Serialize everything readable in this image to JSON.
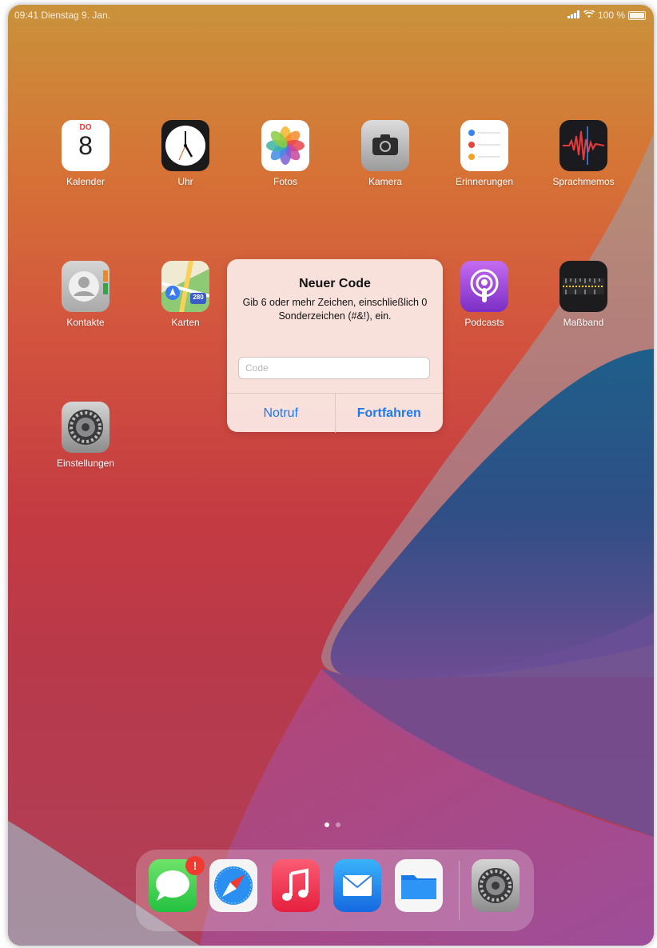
{
  "status_bar": {
    "time_date": "09:41  Dienstag 9. Jan.",
    "battery": "100 %"
  },
  "apps": [
    {
      "label": "Kalender",
      "icon": "calendar-icon",
      "day": "DO",
      "date": "8"
    },
    {
      "label": "Uhr",
      "icon": "clock-icon"
    },
    {
      "label": "Fotos",
      "icon": "photos-icon"
    },
    {
      "label": "Kamera",
      "icon": "camera-icon"
    },
    {
      "label": "Erinnerungen",
      "icon": "reminders-icon"
    },
    {
      "label": "Sprachmemos",
      "icon": "voice-memos-icon"
    },
    {
      "label": "Kontakte",
      "icon": "contacts-icon"
    },
    {
      "label": "Karten",
      "icon": "maps-icon",
      "shield": "280"
    },
    {
      "label": "Podcasts",
      "icon": "podcasts-icon"
    },
    {
      "label": "Maßband",
      "icon": "measure-icon"
    },
    {
      "label": "Einstellungen",
      "icon": "settings-icon"
    }
  ],
  "alert": {
    "title": "Neuer Code",
    "message": "Gib 6 oder mehr Zeichen, einschließlich 0 Sonderzeichen (#&!), ein.",
    "input_placeholder": "Code",
    "input_value": "",
    "secondary_button": "Notruf",
    "primary_button": "Fortfahren",
    "accent_color": "#1a7af0"
  },
  "page_indicator": {
    "pages": 2,
    "current": 1
  },
  "dock": {
    "apps": [
      {
        "icon": "messages-icon",
        "badge": "!"
      },
      {
        "icon": "safari-icon"
      },
      {
        "icon": "music-icon"
      },
      {
        "icon": "mail-icon"
      },
      {
        "icon": "files-icon"
      },
      {
        "icon": "settings-icon"
      }
    ]
  }
}
